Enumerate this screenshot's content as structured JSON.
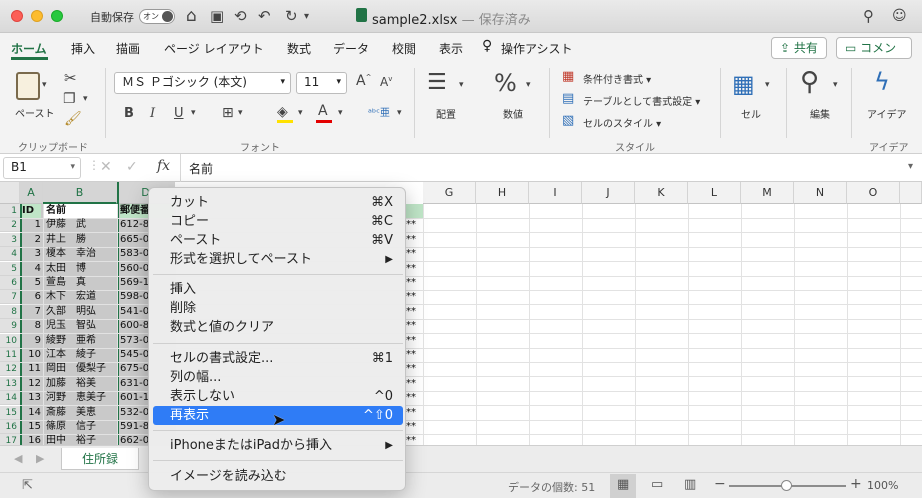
{
  "titlebar": {
    "autosave": "自動保存",
    "toggle": "オン",
    "filename": "sample2.xlsx",
    "status": "— 保存済み"
  },
  "tabs": [
    "ホーム",
    "挿入",
    "描画",
    "ページ レイアウト",
    "数式",
    "データ",
    "校閲",
    "表示",
    "操作アシスト"
  ],
  "share": "共有",
  "comment": "コメント",
  "ribbon": {
    "paste": "ペースト",
    "clipboard": "クリップボード",
    "font_name": "ＭＳ Ｐゴシック (本文)",
    "font_size": "11",
    "font_group": "フォント",
    "align": "配置",
    "number": "数値",
    "cond_format": "条件付き書式",
    "table_format": "テーブルとして書式設定",
    "cell_style": "セルのスタイル",
    "style_group": "スタイル",
    "cells": "セル",
    "edit": "編集",
    "ideas": "アイデア",
    "ideas_group": "アイデア",
    "bold": "B",
    "italic": "I",
    "underline": "U",
    "grow": "A",
    "shrink": "A"
  },
  "formula": {
    "cellref": "B1",
    "fx": "fx",
    "value": "名前"
  },
  "columns": [
    "A",
    "B",
    "D",
    "G",
    "H",
    "I",
    "J",
    "K",
    "L",
    "M",
    "N",
    "O"
  ],
  "header_row": {
    "id": "ID",
    "name": "名前",
    "zip": "郵便番"
  },
  "rows": [
    {
      "n": "1",
      "id": "ID",
      "name": "名前",
      "zip": "郵便番"
    },
    {
      "n": "2",
      "id": "1",
      "name": "伊藤　武",
      "zip": "612-8"
    },
    {
      "n": "3",
      "id": "2",
      "name": "井上　勝",
      "zip": "665-0"
    },
    {
      "n": "4",
      "id": "3",
      "name": "榎本　幸治",
      "zip": "583-0"
    },
    {
      "n": "5",
      "id": "4",
      "name": "太田　博",
      "zip": "560-0"
    },
    {
      "n": "6",
      "id": "5",
      "name": "萱島　真",
      "zip": "569-1"
    },
    {
      "n": "7",
      "id": "6",
      "name": "木下　宏道",
      "zip": "598-0"
    },
    {
      "n": "8",
      "id": "7",
      "name": "久部　明弘",
      "zip": "541-0"
    },
    {
      "n": "9",
      "id": "8",
      "name": "児玉　智弘",
      "zip": "600-8"
    },
    {
      "n": "10",
      "id": "9",
      "name": "綾野　亜希",
      "zip": "573-0"
    },
    {
      "n": "11",
      "id": "10",
      "name": "江本　綾子",
      "zip": "545-0"
    },
    {
      "n": "12",
      "id": "11",
      "name": "岡田　優梨子",
      "zip": "675-0"
    },
    {
      "n": "13",
      "id": "12",
      "name": "加藤　裕美",
      "zip": "631-0"
    },
    {
      "n": "14",
      "id": "13",
      "name": "河野　恵美子",
      "zip": "601-1"
    },
    {
      "n": "15",
      "id": "14",
      "name": "斎藤　美恵",
      "zip": "532-0"
    },
    {
      "n": "16",
      "id": "15",
      "name": "篠原　信子",
      "zip": "591-8"
    },
    {
      "n": "17",
      "id": "16",
      "name": "田中　裕子",
      "zip": "662-0"
    }
  ],
  "hidden_marker": "**",
  "sheet_tab": "住所録",
  "status": {
    "count": "データの個数: 51",
    "zoom": "100%"
  },
  "context_menu": {
    "cut": "カット",
    "cut_sc": "⌘X",
    "copy": "コピー",
    "copy_sc": "⌘C",
    "paste": "ペースト",
    "paste_sc": "⌘V",
    "paste_special": "形式を選択してペースト",
    "insert": "挿入",
    "delete": "削除",
    "clear": "数式と値のクリア",
    "format_cells": "セルの書式設定...",
    "format_cells_sc": "⌘1",
    "col_width": "列の幅...",
    "hide": "表示しない",
    "hide_sc": "^0",
    "unhide": "再表示",
    "unhide_sc": "^⇧0",
    "insert_iphone": "iPhoneまたはiPadから挿入",
    "import_image": "イメージを読み込む",
    "submenu_arrow": "▶"
  }
}
